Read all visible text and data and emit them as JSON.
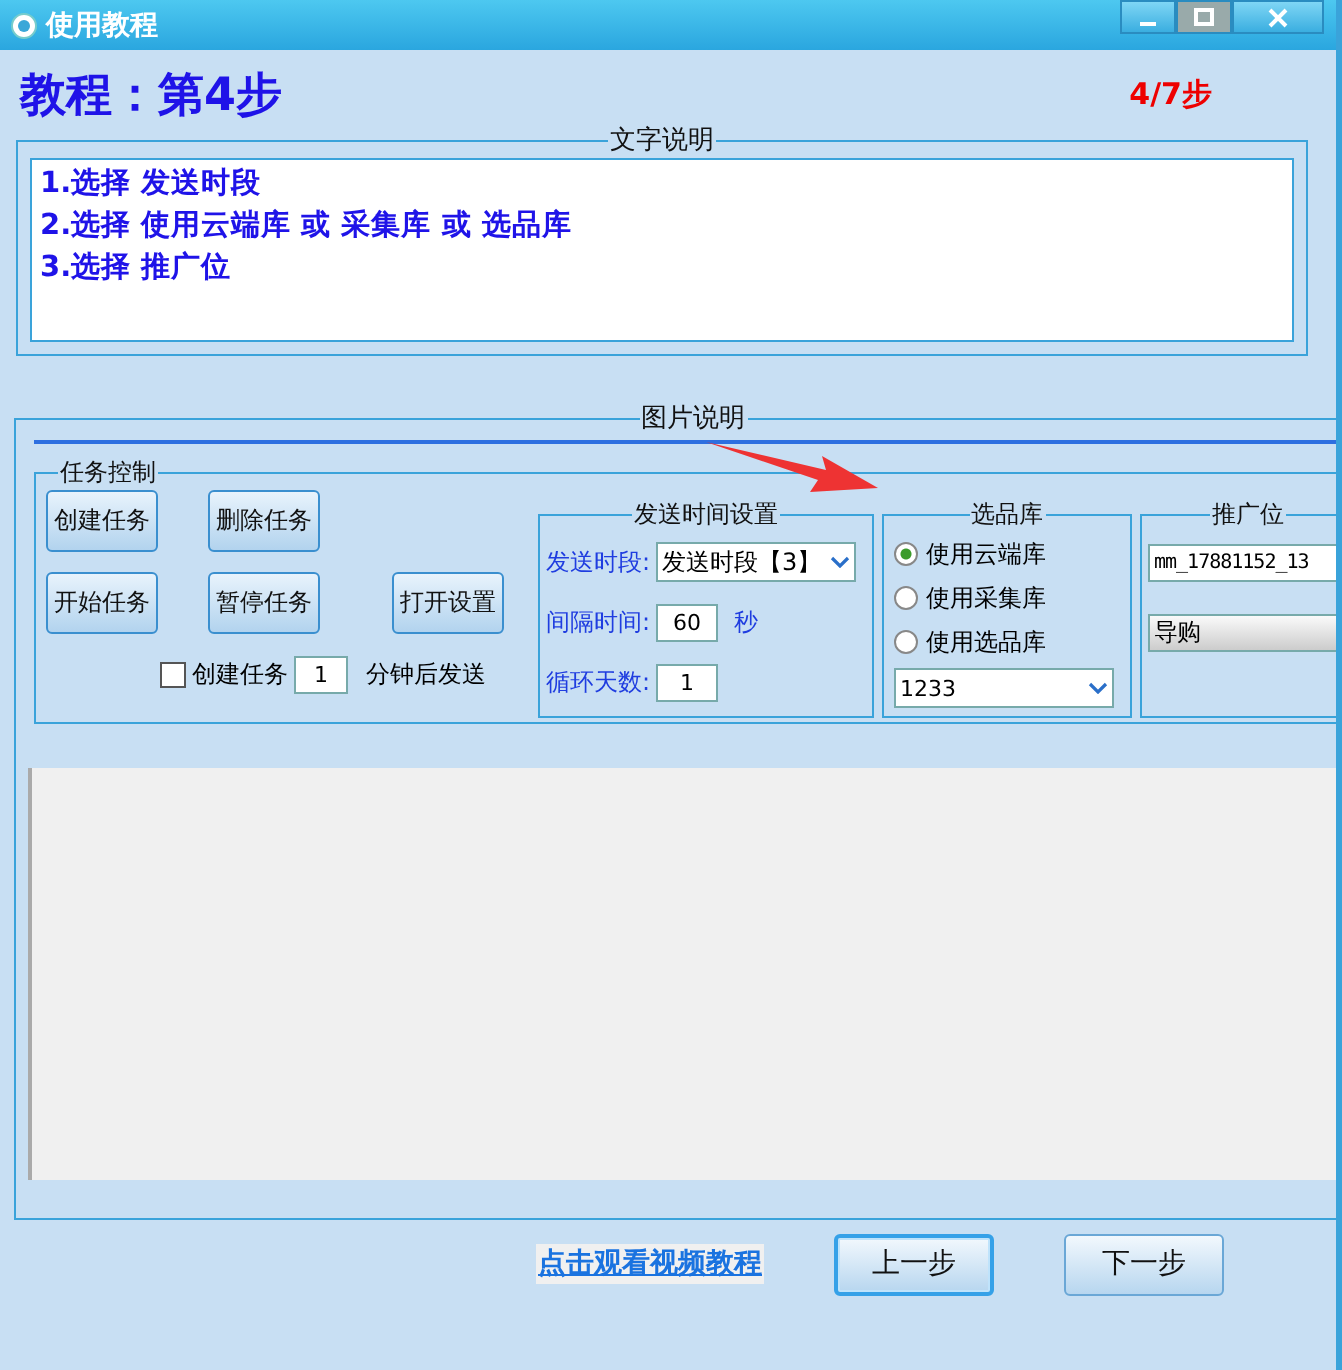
{
  "window": {
    "title": "使用教程"
  },
  "header": {
    "title": "教程：第4步",
    "progress": "4/7步"
  },
  "text_section": {
    "legend": "文字说明",
    "lines": [
      "1.选择 发送时段",
      "2.选择 使用云端库 或 采集库 或 选品库",
      "3.选择 推广位"
    ]
  },
  "picture_section": {
    "legend": "图片说明",
    "screenshot": {
      "task_control": {
        "legend": "任务控制",
        "buttons": [
          "创建任务",
          "删除任务",
          "开始任务",
          "暂停任务",
          "打开设置"
        ],
        "delay": {
          "checked": false,
          "label": "创建任务",
          "value": "1",
          "suffix": "分钟后发送"
        }
      },
      "send_time": {
        "legend": "发送时间设置",
        "period": {
          "label": "发送时段:",
          "value": "发送时段【3】"
        },
        "interval": {
          "label": "间隔时间:",
          "value": "60",
          "unit": "秒"
        },
        "days": {
          "label": "循环天数:",
          "value": "1"
        }
      },
      "library": {
        "legend": "选品库",
        "options": [
          {
            "label": "使用云端库",
            "selected": true
          },
          {
            "label": "使用采集库",
            "selected": false
          },
          {
            "label": "使用选品库",
            "selected": false
          }
        ],
        "dropdown": "1233"
      },
      "promo": {
        "legend": "推广位",
        "pid": "mm_17881152_13",
        "type": "导购"
      }
    }
  },
  "footer": {
    "video_link": "点击观看视频教程",
    "buttons": [
      {
        "label": "上一步",
        "focused": true
      },
      {
        "label": "下一步",
        "focused": false
      }
    ]
  }
}
